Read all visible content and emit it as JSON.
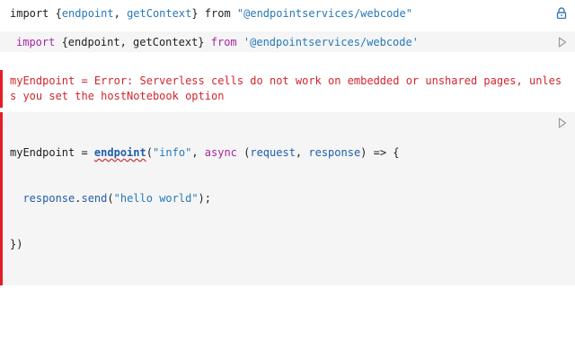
{
  "output_cell": {
    "tokens": [
      "import",
      " {",
      "endpoint",
      ", ",
      "getContext",
      "} ",
      "from",
      " ",
      "\"@endpointservices/webcode\""
    ]
  },
  "input_cell_1": {
    "tokens": [
      "import",
      " {endpoint, getContext} ",
      "from",
      " ",
      "'@endpointservices/webcode'"
    ]
  },
  "error_cell": {
    "message": "myEndpoint = Error: Serverless cells do not work on embedded or unshared pages, unless you set the hostNotebook option"
  },
  "input_cell_2": {
    "line1": {
      "a": "myEndpoint = ",
      "fn": "endpoint",
      "b": "(",
      "str": "\"info\"",
      "c": ", ",
      "kw": "async",
      "d": " (",
      "p1": "request",
      "e": ", ",
      "p2": "response",
      "f": ") => {"
    },
    "line2": {
      "indent": "  ",
      "obj": "response",
      "dot": ".",
      "method": "send",
      "open": "(",
      "str": "\"hello world\"",
      "close": ");"
    },
    "line3": "})"
  },
  "icons": {
    "lock": "lock-icon",
    "run": "play-icon"
  },
  "colors": {
    "error": "#e41e27",
    "string": "#2679b8",
    "keyword": "#a626a4"
  }
}
